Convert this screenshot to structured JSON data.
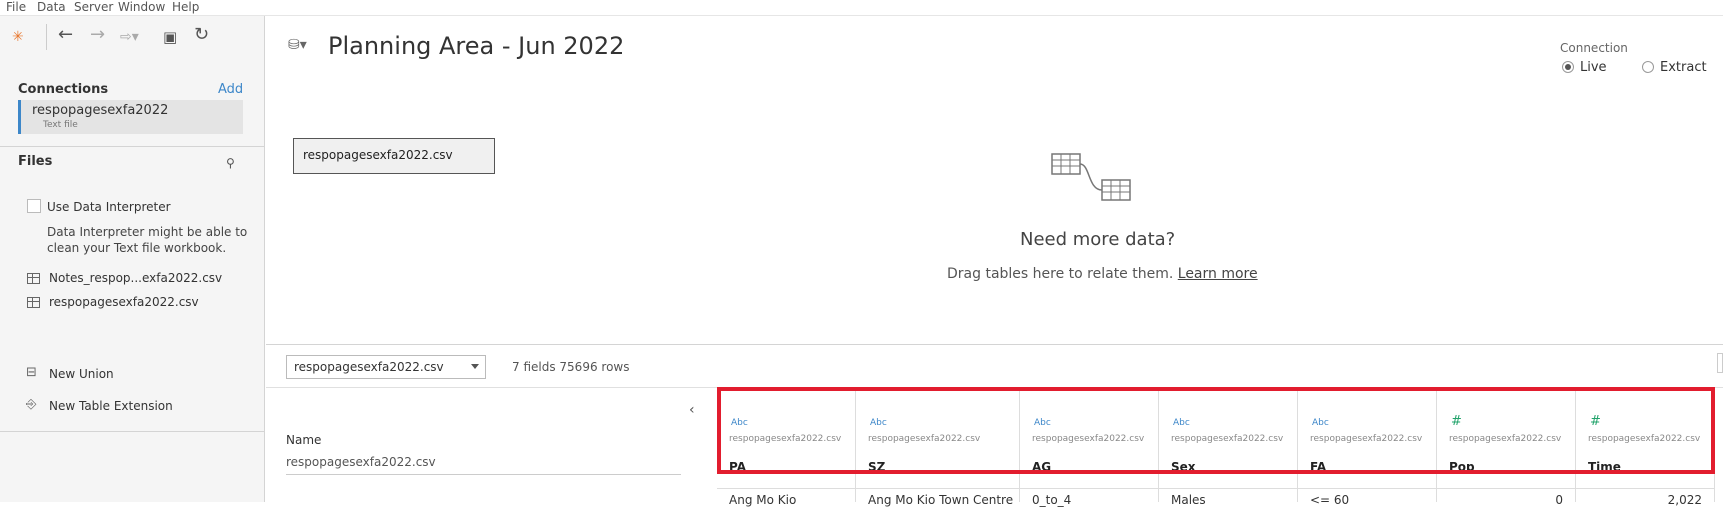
{
  "menu": [
    "File",
    "Data",
    "Server",
    "Window",
    "Help"
  ],
  "toolbar": {
    "logo": "tableau-logo-icon",
    "back": "back-arrow-icon",
    "forward": "forward-arrow-icon",
    "redo": "redo-icon",
    "save": "save-icon",
    "refresh": "refresh-icon"
  },
  "connections": {
    "title": "Connections",
    "add_label": "Add",
    "items": [
      {
        "name": "respopagesexfa2022",
        "type": "Text file"
      }
    ]
  },
  "files": {
    "title": "Files",
    "interpreter_label": "Use Data Interpreter",
    "interpreter_hint_1": "Data Interpreter might be able to",
    "interpreter_hint_2": "clean your Text file workbook.",
    "items": [
      "Notes_respop...exfa2022.csv",
      "respopagesexfa2022.csv"
    ],
    "new_union": "New Union",
    "new_table_extension": "New Table Extension"
  },
  "canvas": {
    "title": "Planning Area - Jun 2022",
    "connection_label": "Connection",
    "live_label": "Live",
    "extract_label": "Extract",
    "selected_connection": "Live",
    "table_name": "respopagesexfa2022.csv",
    "need_more_title": "Need more data?",
    "need_more_text": "Drag tables here to relate them.",
    "learn_more": "Learn more"
  },
  "data_grid": {
    "table_select": "respopagesexfa2022.csv",
    "fields_info": "7 fields 75696 rows",
    "meta_name_label": "Name",
    "meta_name_value": "respopagesexfa2022.csv",
    "columns": [
      {
        "type_label": "Abc",
        "type": "string",
        "source": "respopagesexfa2022.csv",
        "name": "PA",
        "first_value": "Ang Mo Kio"
      },
      {
        "type_label": "Abc",
        "type": "string",
        "source": "respopagesexfa2022.csv",
        "name": "SZ",
        "first_value": "Ang Mo Kio Town Centre"
      },
      {
        "type_label": "Abc",
        "type": "string",
        "source": "respopagesexfa2022.csv",
        "name": "AG",
        "first_value": "0_to_4"
      },
      {
        "type_label": "Abc",
        "type": "string",
        "source": "respopagesexfa2022.csv",
        "name": "Sex",
        "first_value": "Males"
      },
      {
        "type_label": "Abc",
        "type": "string",
        "source": "respopagesexfa2022.csv",
        "name": "FA",
        "first_value": "<= 60"
      },
      {
        "type_label": "#",
        "type": "number",
        "source": "respopagesexfa2022.csv",
        "name": "Pop",
        "first_value": "0"
      },
      {
        "type_label": "#",
        "type": "number",
        "source": "respopagesexfa2022.csv",
        "name": "Time",
        "first_value": "2,022"
      }
    ]
  },
  "colors": {
    "accent": "#3d87c9",
    "highlight": "#e21d2e",
    "number_type": "#22a36b"
  }
}
